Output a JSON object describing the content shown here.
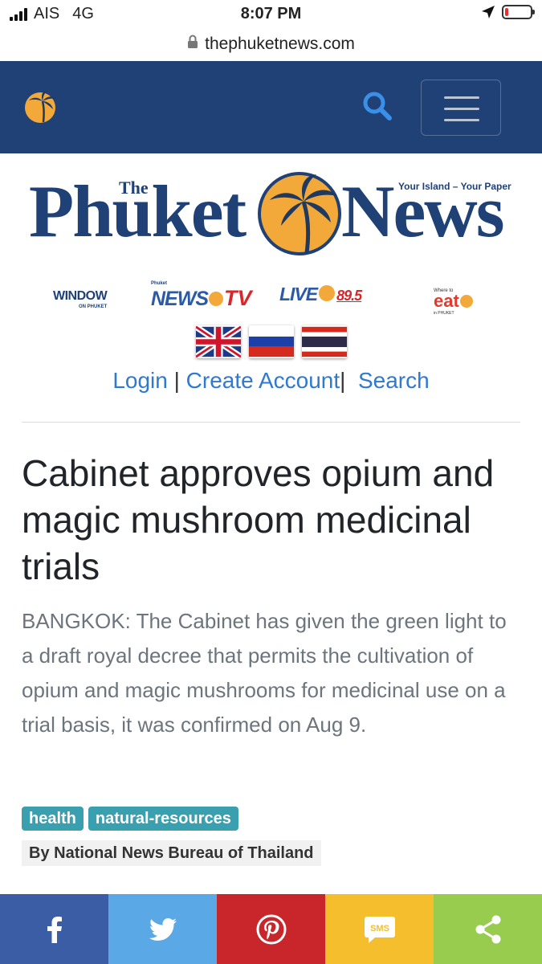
{
  "status_bar": {
    "carrier": "AIS",
    "network": "4G",
    "time": "8:07 PM",
    "battery_level": 0.12,
    "battery_color": "#e5312b"
  },
  "browser": {
    "url": "thephuketnews.com"
  },
  "navbar": {
    "background": "#1f4176",
    "search_icon": "search-icon",
    "menu_icon": "hamburger-icon"
  },
  "masthead": {
    "the": "The",
    "name_part1": "Phuket",
    "name_part2": "News",
    "tagline": "Your Island – Your Paper"
  },
  "partners": {
    "window": "WINDOW",
    "window_sub": "ON PHUKET",
    "newstv_small": "Phuket",
    "newstv_news": "NEWS",
    "newstv_tv": "TV",
    "live": "LIVE",
    "live_freq": "89.5",
    "eat_small": "Where to",
    "eat": "eat",
    "eat_sub": "in PHUKET"
  },
  "flags": [
    "uk-flag",
    "russia-flag",
    "thailand-flag"
  ],
  "account": {
    "login": "Login",
    "create": "Create Account",
    "search": "Search",
    "sep": "|"
  },
  "article": {
    "headline": "Cabinet approves opium and magic mushroom medicinal trials",
    "lead": "BANGKOK: The Cabinet has given the green light to a draft royal decree that permits the cultivation of opium and magic mushrooms for medicinal use on a trial basis, it was confirmed on Aug 9.",
    "tags": [
      "health",
      "natural-resources"
    ],
    "byline": "By National News Bureau of Thailand"
  },
  "share": [
    {
      "name": "facebook",
      "color": "#3b5da6"
    },
    {
      "name": "twitter",
      "color": "#5aa9e6"
    },
    {
      "name": "pinterest",
      "color": "#c8262b"
    },
    {
      "name": "sms",
      "color": "#f5be2c",
      "label": "SMS"
    },
    {
      "name": "share",
      "color": "#98cc4f"
    }
  ]
}
